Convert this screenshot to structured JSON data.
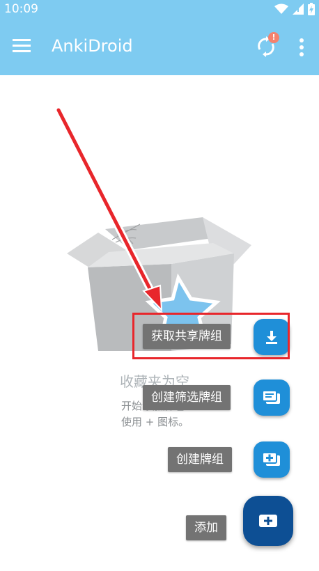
{
  "status_bar": {
    "time": "10:09",
    "icons": [
      "wifi-icon",
      "signal-icon",
      "battery-icon"
    ]
  },
  "app_bar": {
    "title": "AnkiDroid",
    "sync_badge": "!",
    "icons": [
      "menu-icon",
      "sync-icon",
      "more-vert-icon"
    ],
    "color": "#7ecbf1"
  },
  "empty_state": {
    "title": "收藏夹为空",
    "line1": "开始添加牌组",
    "line2": "使用 + 图标。"
  },
  "fab_menu": {
    "items": [
      {
        "label": "获取共享牌组",
        "icon": "download-icon"
      },
      {
        "label": "创建筛选牌组",
        "icon": "filtered-deck-icon"
      },
      {
        "label": "创建牌组",
        "icon": "add-deck-icon"
      }
    ],
    "main": {
      "label": "添加",
      "icon": "add-card-icon"
    },
    "mini_color": "#1f8fd8",
    "main_color": "#0d4f94"
  },
  "annotation": {
    "highlight_color": "#e8262b"
  }
}
